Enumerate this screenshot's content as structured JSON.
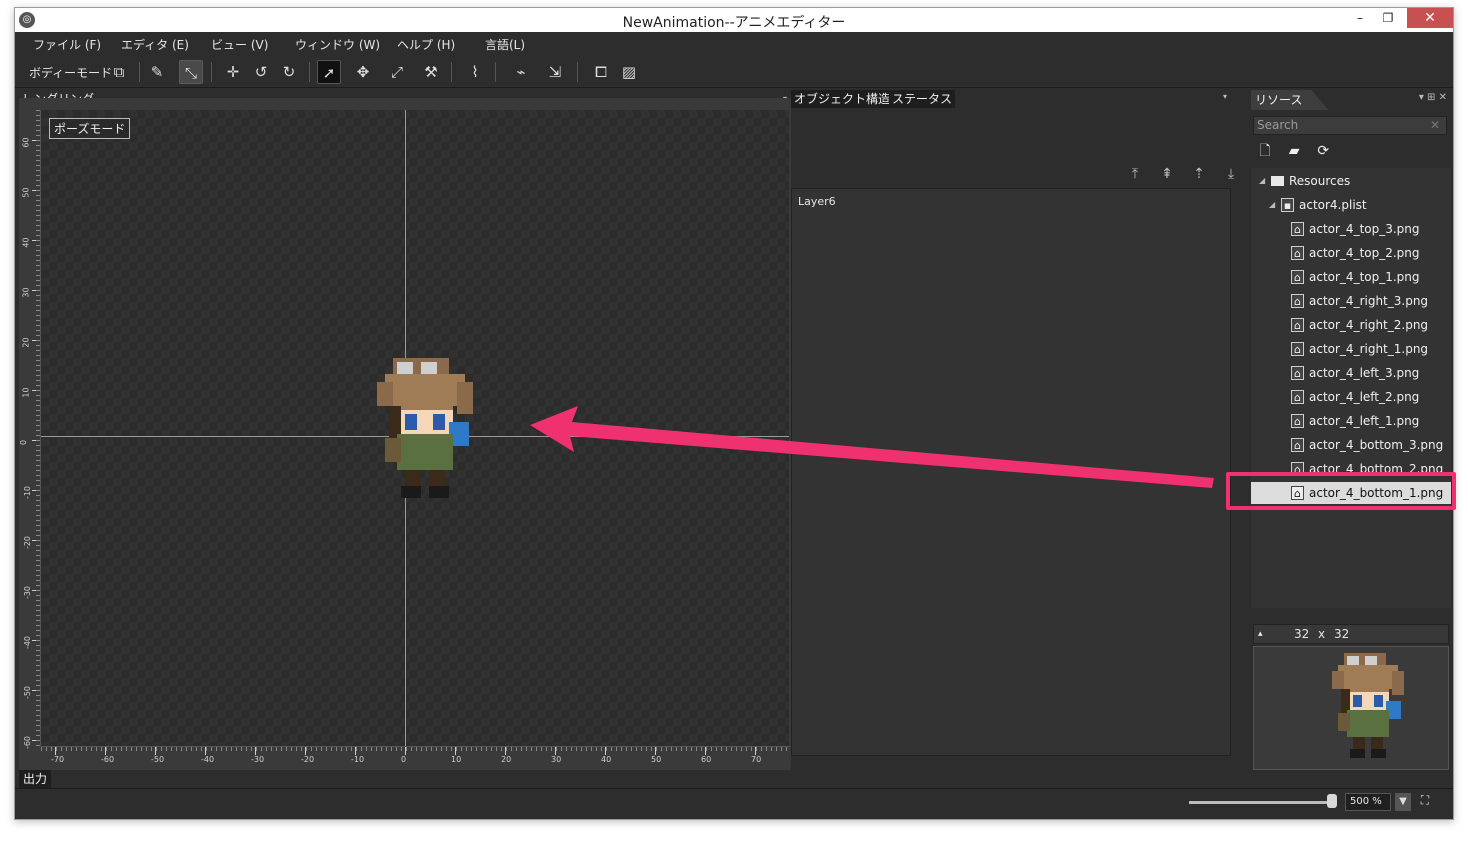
{
  "window": {
    "title": "NewAnimation--アニメエディター"
  },
  "menu": [
    "ファイル (F)",
    "エディタ (E)",
    "ビュー (V)",
    "ウィンドウ (W)",
    "ヘルプ (H)",
    "言語(L)"
  ],
  "toolbar": {
    "mode_label": "ボディーモード",
    "tools": [
      "body-edit-icon",
      "bone-icon",
      "bone-select-icon",
      "pivot-icon",
      "rotate-left-icon",
      "rotate-right-icon",
      "select-arrow-icon",
      "move-icon",
      "scale-icon",
      "ik-icon",
      "bone-add-icon",
      "bone-remove-icon",
      "bone-bind-icon",
      "frame-icon",
      "image-edit-icon"
    ]
  },
  "render_panel": {
    "title": "レンダリング",
    "pose_mode_button": "ポーズモード",
    "ruler_v_labels": [
      "60",
      "50",
      "40",
      "30",
      "20",
      "10",
      "0",
      "-10",
      "-20",
      "-30",
      "-40",
      "-50",
      "-60"
    ],
    "ruler_h_labels": [
      "-70",
      "-60",
      "-50",
      "-40",
      "-30",
      "-20",
      "-10",
      "0",
      "10",
      "20",
      "30",
      "40",
      "50",
      "60",
      "70"
    ]
  },
  "object_panel": {
    "tabs": [
      "オブジェクト構造",
      "ステータス"
    ],
    "close_glyph": "×",
    "layer_label": "Layer6"
  },
  "resource_panel": {
    "title": "リソース",
    "search_placeholder": "Search",
    "tree": [
      {
        "label": "Resources",
        "depth": 0,
        "type": "folder"
      },
      {
        "label": "actor4.plist",
        "depth": 1,
        "type": "plist"
      },
      {
        "label": "actor_4_top_3.png",
        "depth": 2,
        "type": "image"
      },
      {
        "label": "actor_4_top_2.png",
        "depth": 2,
        "type": "image"
      },
      {
        "label": "actor_4_top_1.png",
        "depth": 2,
        "type": "image"
      },
      {
        "label": "actor_4_right_3.png",
        "depth": 2,
        "type": "image"
      },
      {
        "label": "actor_4_right_2.png",
        "depth": 2,
        "type": "image"
      },
      {
        "label": "actor_4_right_1.png",
        "depth": 2,
        "type": "image"
      },
      {
        "label": "actor_4_left_3.png",
        "depth": 2,
        "type": "image"
      },
      {
        "label": "actor_4_left_2.png",
        "depth": 2,
        "type": "image"
      },
      {
        "label": "actor_4_left_1.png",
        "depth": 2,
        "type": "image"
      },
      {
        "label": "actor_4_bottom_3.png",
        "depth": 2,
        "type": "image"
      },
      {
        "label": "actor_4_bottom_2.png",
        "depth": 2,
        "type": "image"
      },
      {
        "label": "actor_4_bottom_1.png",
        "depth": 2,
        "type": "image",
        "selected": true
      }
    ],
    "preview": {
      "width": "32",
      "sep": "x",
      "height": "32"
    }
  },
  "output_tab": "出力",
  "status_bar": {
    "zoom": "500 %"
  },
  "colors": {
    "highlight": "#f0316f",
    "background": "#2d2d2d"
  }
}
